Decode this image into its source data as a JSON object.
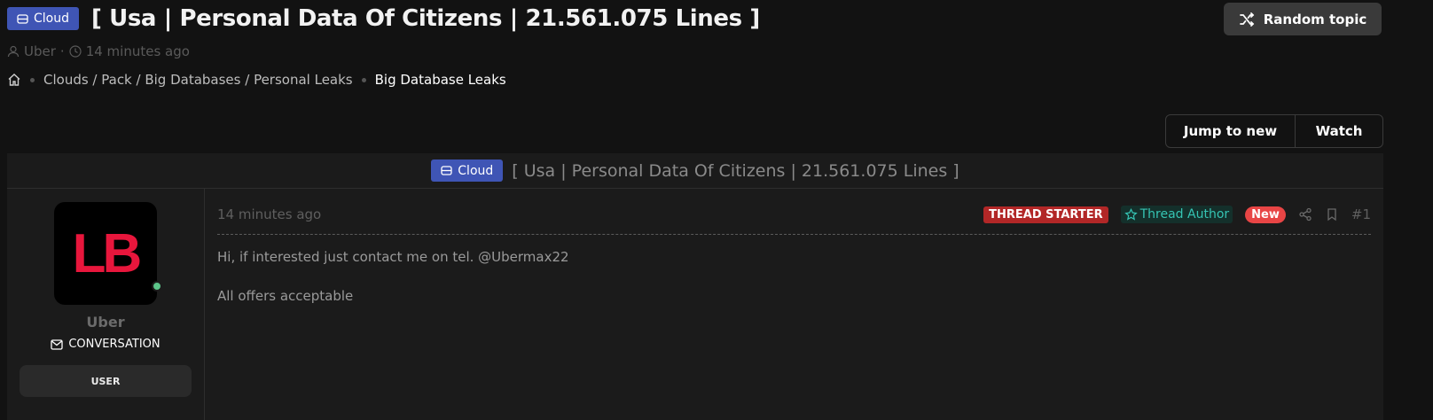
{
  "header": {
    "prefix_label": "Cloud",
    "title": "[ Usa | Personal Data Of Citizens | 21.561.075 Lines ]",
    "author": "Uber",
    "separator": "·",
    "time": "14 minutes ago"
  },
  "breadcrumb": {
    "items": [
      "Clouds / Pack / Big Databases / Personal Leaks"
    ],
    "current": "Big Database Leaks"
  },
  "actions": {
    "random_topic": "Random topic",
    "jump_to_new": "Jump to new",
    "watch": "Watch"
  },
  "thread": {
    "prefix_label": "Cloud",
    "title": "[ Usa | Personal Data Of Citizens | 21.561.075 Lines ]"
  },
  "post": {
    "user": {
      "avatar_text": "LB",
      "name": "Uber",
      "conversation_label": "CONVERSATION",
      "role": "USER",
      "online": true
    },
    "time": "14 minutes ago",
    "tags": {
      "starter": "THREAD STARTER",
      "author": "Thread Author",
      "new": "New"
    },
    "number": "#1",
    "body": [
      "Hi, if interested just contact me on tel. @Ubermax22",
      "All offers acceptable"
    ]
  },
  "colors": {
    "background": "#121212",
    "cloud_badge": "#3f55b5",
    "thread_starter": "#b22727",
    "thread_author_text": "#35c4b3",
    "new_badge": "#e84545",
    "avatar_logo": "#e8163c",
    "online": "#5cc58a"
  }
}
